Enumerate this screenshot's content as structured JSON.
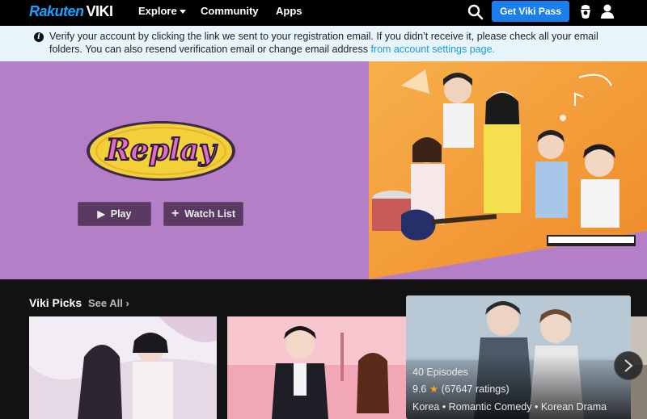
{
  "nav": {
    "logo_rakuten": "Rakuten",
    "logo_viki": "VIKI",
    "explore": "Explore",
    "community": "Community",
    "apps": "Apps",
    "pass_button": "Get Viki Pass"
  },
  "notice": {
    "text": "Verify your account by clicking the link we sent to your registration email. If you didn’t receive it, please check all your email folders. You can also resend verification email or change email address ",
    "link": "from account settings page."
  },
  "hero": {
    "show_logo": "Replay",
    "play": "Play",
    "watch_list": "Watch List"
  },
  "picks": {
    "title": "Viki Picks",
    "see_all": "See All",
    "featured": {
      "episodes": "40 Episodes",
      "rating_value": "9.6",
      "rating_count": "(67647 ratings)",
      "genres": "Korea • Romantic Comedy • Korean Drama"
    }
  },
  "colors": {
    "accent": "#1a7fea",
    "hero_bg": "#b57fc8",
    "notice_bg": "#e8f4fb",
    "link": "#1a9ad6"
  }
}
